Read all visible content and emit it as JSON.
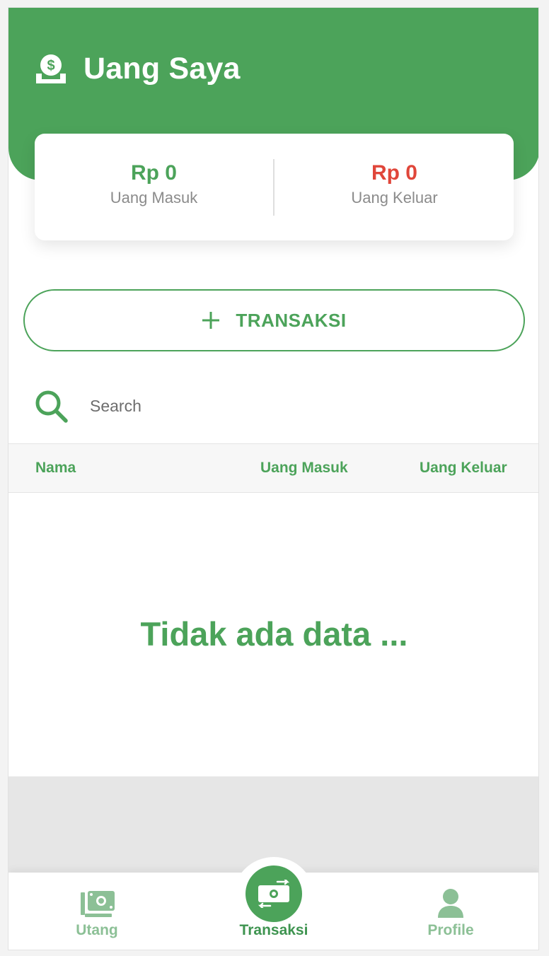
{
  "header": {
    "title": "Uang Saya",
    "icon": "money-deposit-icon",
    "background_color": "#4ca35a"
  },
  "summary": {
    "income": {
      "value": "Rp 0",
      "label": "Uang Masuk",
      "color": "#4ca35a"
    },
    "expense": {
      "value": "Rp 0",
      "label": "Uang Keluar",
      "color": "#e0463a"
    }
  },
  "add_transaction": {
    "label": "TRANSAKSI",
    "icon": "plus-icon"
  },
  "search": {
    "placeholder": "Search",
    "value": "",
    "icon": "search-icon"
  },
  "table": {
    "columns": [
      "Nama",
      "Uang Masuk",
      "Uang Keluar"
    ],
    "rows": [],
    "empty_message": "Tidak ada data ..."
  },
  "bottom_nav": {
    "items": [
      {
        "label": "Utang",
        "icon": "money-stack-icon",
        "active": false
      },
      {
        "label": "Transaksi",
        "icon": "money-exchange-icon",
        "active": true
      },
      {
        "label": "Profile",
        "icon": "user-icon",
        "active": false
      }
    ]
  }
}
